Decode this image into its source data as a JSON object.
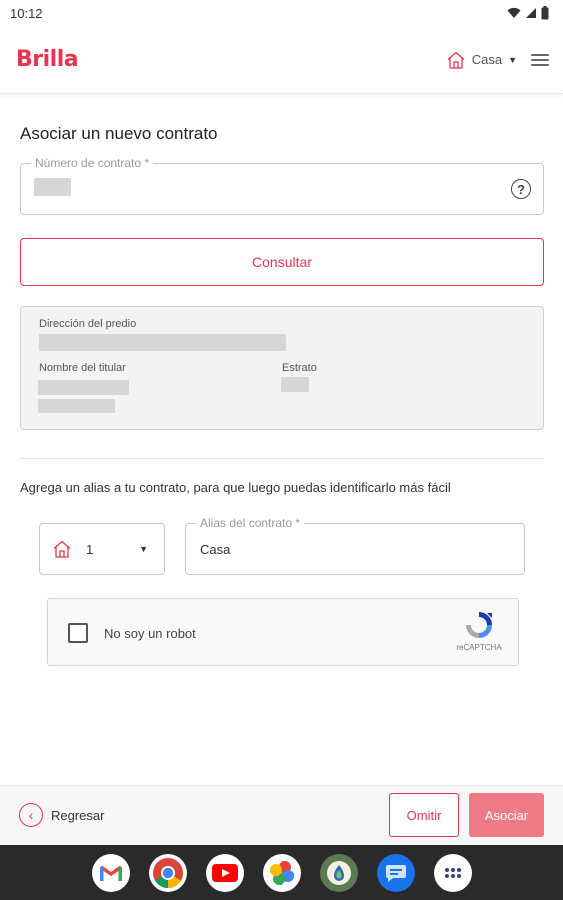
{
  "status_bar": {
    "time": "10:12"
  },
  "header": {
    "logo": "Brilla",
    "property_selector": "Casa",
    "icons": {
      "property": "house-icon",
      "menu": "hamburger-menu-icon"
    }
  },
  "form": {
    "title": "Asociar un nuevo contrato",
    "contract_number": {
      "label": "Número de contrato *",
      "value": ""
    },
    "consult_button": "Consultar",
    "info": {
      "address_label": "Dirección del predio",
      "holder_label": "Nombre del titular",
      "stratum_label": "Estrato"
    },
    "alias_hint": "Agrega un alias a tu contrato, para que luego puedas identificarlo más fácil",
    "icon_select": {
      "value": "1",
      "icon": "house-icon"
    },
    "alias_field": {
      "label": "Alias del contrato *",
      "value": "Casa"
    },
    "captcha": {
      "label": "No soy un robot",
      "brand": "reCAPTCHA"
    }
  },
  "footer": {
    "back_label": "Regresar",
    "skip_button": "Omitir",
    "submit_button": "Asociar"
  },
  "dock": {
    "apps": [
      "gmail-icon",
      "chrome-icon",
      "youtube-icon",
      "photos-icon",
      "app-icon",
      "messages-icon",
      "app-drawer-icon"
    ]
  },
  "colors": {
    "brand": "#e8344e",
    "brand_light": "#ee7a86",
    "card_bg": "#f3f3f3"
  }
}
